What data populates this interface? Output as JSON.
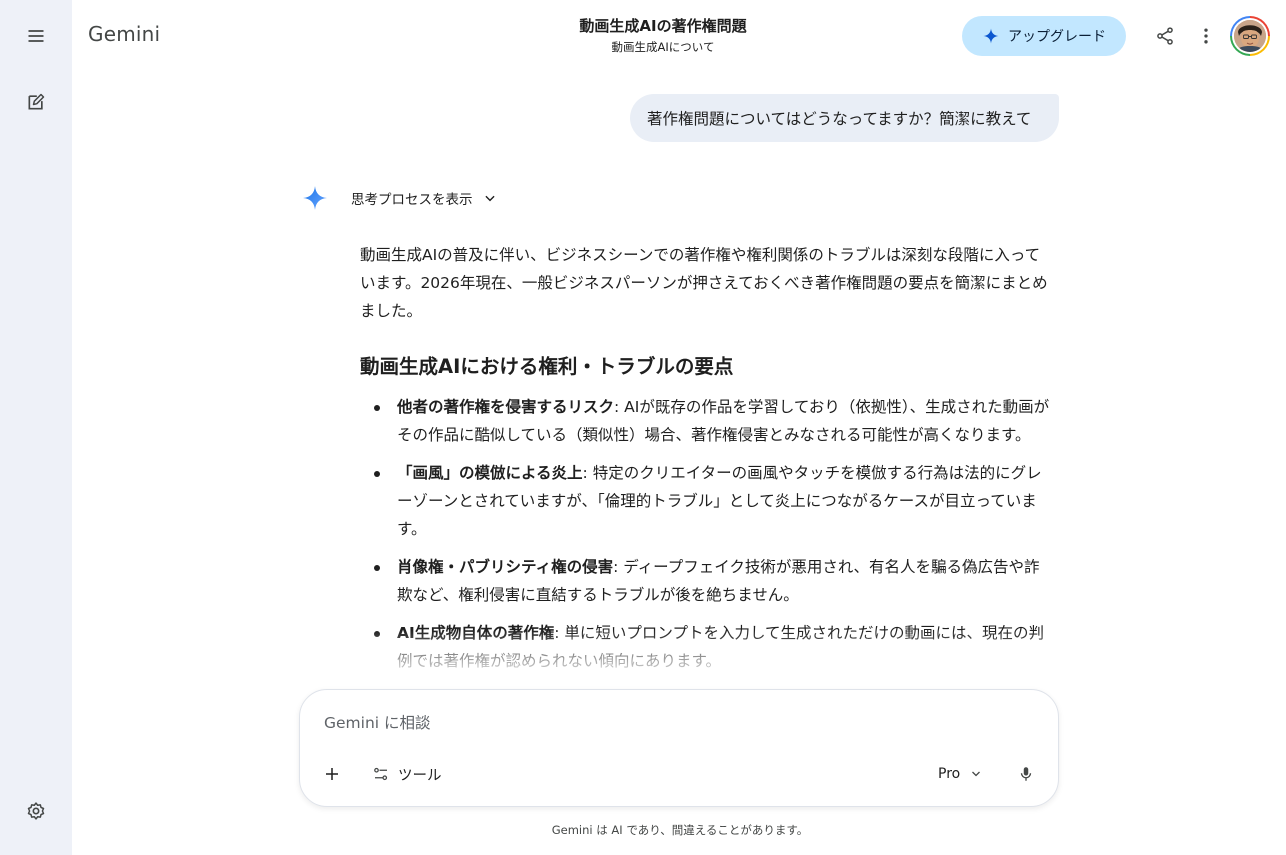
{
  "app": {
    "brand": "Gemini"
  },
  "header": {
    "title": "動画生成AIの著作権問題",
    "subtitle": "動画生成AIについて",
    "upgrade_label": "アップグレード"
  },
  "rail": {
    "icons": [
      "menu-icon",
      "new-chat-icon",
      "settings-icon"
    ]
  },
  "conversation": {
    "user_message": "著作権問題についてはどうなってますか？簡潔に教えて",
    "thinking_label": "思考プロセスを表示",
    "response": {
      "intro": "動画生成AIの普及に伴い、ビジネスシーンでの著作権や権利関係のトラブルは深刻な段階に入っています。2026年現在、一般ビジネスパーソンが押さえておくべき著作権問題の要点を簡潔にまとめました。",
      "heading": "動画生成AIにおける権利・トラブルの要点",
      "bullets": [
        {
          "title": "他者の著作権を侵害するリスク",
          "text": ": AIが既存の作品を学習しており（依拠性）、生成された動画がその作品に酷似している（類似性）場合、著作権侵害とみなされる可能性が高くなります。"
        },
        {
          "title": "「画風」の模倣による炎上",
          "text": ": 特定のクリエイターの画風やタッチを模倣する行為は法的にグレーゾーンとされていますが、「倫理的トラブル」として炎上につながるケースが目立っています。"
        },
        {
          "title": "肖像権・パブリシティ権の侵害",
          "text": ": ディープフェイク技術が悪用され、有名人を騙る偽広告や詐欺など、権利侵害に直結するトラブルが後を絶ちません。"
        },
        {
          "title": "AI生成物自体の著作権",
          "text": ": 単に短いプロンプトを入力して生成されただけの動画には、現在の判例では著作権が認められない傾向にあります。"
        }
      ]
    }
  },
  "composer": {
    "placeholder": "Gemini に相談",
    "tools_label": "ツール",
    "model_label": "Pro"
  },
  "footer": {
    "disclaimer": "Gemini は AI であり、間違えることがあります。"
  },
  "colors": {
    "rail_bg": "#eef1f8",
    "upgrade_bg": "#c2e7ff",
    "user_bubble_bg": "#e9eef6",
    "spark_blue": "#4285f4"
  }
}
